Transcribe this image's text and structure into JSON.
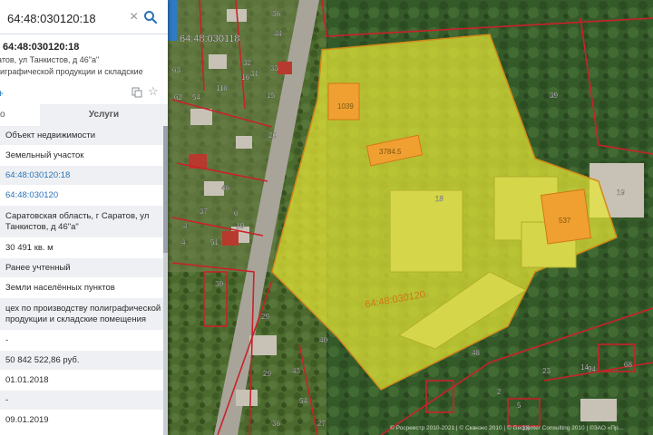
{
  "search": {
    "value": "64:48:030120:18"
  },
  "object": {
    "title": "64:48:030120:18",
    "address_short": "ратов, ул Танкистов, д 46\"а\"",
    "purpose_short": "олиграфической продукции и складские"
  },
  "tabs": {
    "info": "о",
    "services": "Услуги"
  },
  "fields": [
    {
      "text": "Объект недвижимости",
      "h": 22,
      "link": false
    },
    {
      "text": "Земельный участок",
      "h": 22,
      "link": false
    },
    {
      "text": "64:48:030120:18",
      "h": 22,
      "link": true
    },
    {
      "text": "64:48:030120",
      "h": 22,
      "link": true
    },
    {
      "text": "Саратовская область, г Саратов, ул Танкистов, д 46\"а\"",
      "h": 36,
      "link": false
    },
    {
      "text": "30 491 кв. м",
      "h": 22,
      "link": false
    },
    {
      "text": "Ранее учтенный",
      "h": 22,
      "link": false
    },
    {
      "text": "Земли населённых пунктов",
      "h": 22,
      "link": false
    },
    {
      "text": "цех по производству полиграфической продукции и складские помещения",
      "h": 36,
      "link": false
    },
    {
      "text": "-",
      "h": 22,
      "link": false
    },
    {
      "text": "50 842 522,86 руб.",
      "h": 22,
      "link": false
    },
    {
      "text": "01.01.2018",
      "h": 22,
      "link": false
    },
    {
      "text": "-",
      "h": 22,
      "link": false
    },
    {
      "text": "09.01.2019",
      "h": 22,
      "link": false
    }
  ],
  "map": {
    "parcel_label": "64:48:030120",
    "block_label": "64:48:030118",
    "numbers": [
      "18",
      "39",
      "19",
      "40",
      "43",
      "48",
      "27",
      "30",
      "29",
      "36",
      "32",
      "33",
      "31",
      "15",
      "16",
      "116",
      "63",
      "62",
      "54",
      "44",
      "37",
      "46",
      "51",
      "29",
      "54",
      "18",
      "14",
      "4",
      "4",
      "6",
      "10",
      "94",
      "68",
      "23",
      "2",
      "5",
      "36",
      "20"
    ],
    "building_labels": [
      "1039",
      "3784.5",
      "537"
    ],
    "copyright": "© Росреестр 2010-2021 | © Сканэкс 2010 | © Geocenter Consulting 2010 | ©ЗАО «Пр..."
  },
  "colors": {
    "parcel_fill": "#e6e635",
    "parcel_stroke": "#d28a18",
    "boundary": "#c8222a",
    "building_fill": "#f0a030",
    "accent": "#2a73b8"
  }
}
